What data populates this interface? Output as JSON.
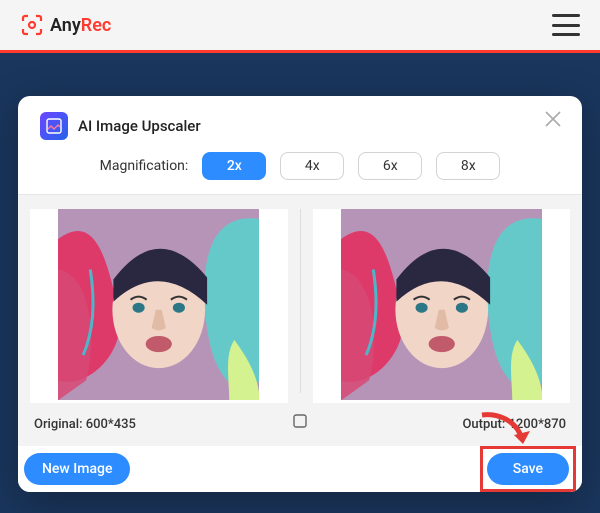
{
  "brand": {
    "textA": "Any",
    "textB": "Rec"
  },
  "modal": {
    "title": "AI Image Upscaler",
    "mag_label": "Magnification:",
    "pills": [
      "2x",
      "4x",
      "6x",
      "8x"
    ],
    "active_index": 0,
    "original_lbl": "Original: 600*435",
    "output_lbl": "Output: 1200*870"
  },
  "footer": {
    "new_image": "New Image",
    "save": "Save"
  }
}
